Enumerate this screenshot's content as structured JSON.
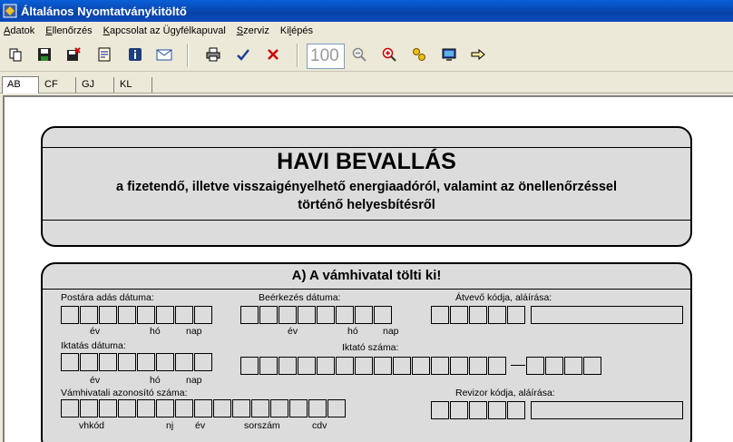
{
  "window": {
    "title": "Általános Nyomtatványkitöltő"
  },
  "menu": [
    {
      "pre": "",
      "u": "A",
      "post": "datok"
    },
    {
      "pre": "",
      "u": "E",
      "post": "llenőrzés"
    },
    {
      "pre": "",
      "u": "K",
      "post": "apcsolat az Ügyfélkapuval"
    },
    {
      "pre": "",
      "u": "S",
      "post": "zerviz"
    },
    {
      "pre": "Ki",
      "u": "l",
      "post": "épés"
    }
  ],
  "toolbar": {
    "zoom_value": "100",
    "buttons": [
      "copy-icon",
      "save-icon",
      "save-close-icon",
      "edit-doc-icon",
      "info-icon",
      "mail-icon",
      "print-icon",
      "check-icon",
      "cancel-icon",
      "zoom-out-icon",
      "zoom-in-icon",
      "settings-icon",
      "screen-icon",
      "pointer-icon"
    ]
  },
  "tabs": [
    "AB",
    "CF",
    "GJ",
    "KL"
  ],
  "form": {
    "title": "HAVI BEVALLÁS",
    "subtitle_line1": "a fizetendő, illetve visszaigényelhető energiaadóról, valamint az önellenőrzéssel",
    "subtitle_line2": "történő helyesbítésről",
    "section_a": {
      "title": "A) A vámhivatal tölti ki!",
      "postal_date_label": "Postára adás dátuma:",
      "arrival_date_label": "Beérkezés dátuma:",
      "receiver_label": "Átvevő kódja, aláírása:",
      "filing_date_label": "Iktatás dátuma:",
      "filing_number_label": "Iktató száma:",
      "customs_id_label": "Vámhivatali azonosító száma:",
      "auditor_label": "Revizor kódja, aláírása:",
      "year": "év",
      "month": "hó",
      "day": "nap",
      "vhkod": "vhkód",
      "nj": "nj",
      "sorszam": "sorszám",
      "cdv": "cdv"
    }
  },
  "colors": {
    "titlebar": "#0842a8",
    "panel_bg": "#dcdcdc",
    "window_bg": "#ece9d8"
  }
}
